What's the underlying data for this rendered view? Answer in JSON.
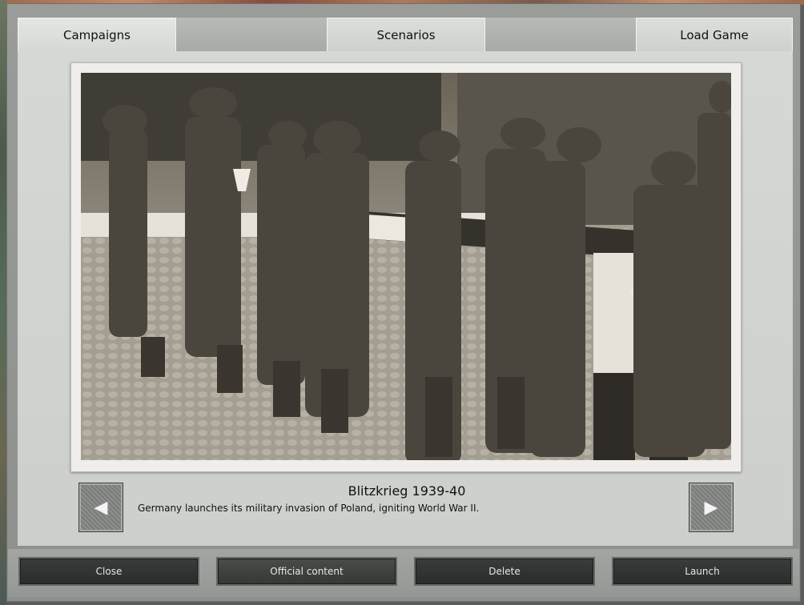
{
  "tabs": {
    "campaigns": "Campaigns",
    "scenarios": "Scenarios",
    "load_game": "Load Game"
  },
  "campaign": {
    "title": "Blitzkrieg 1939-40",
    "description": "Germany launches its military invasion of Poland, igniting World War II."
  },
  "nav": {
    "prev_icon": "◀",
    "next_icon": "▶"
  },
  "buttons": {
    "close": "Close",
    "official_content": "Official content",
    "delete": "Delete",
    "launch": "Launch"
  }
}
